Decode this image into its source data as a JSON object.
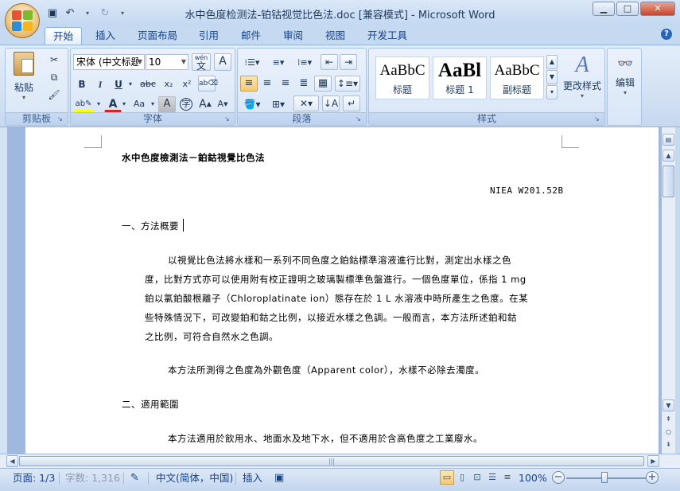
{
  "window": {
    "title": "水中色度检测法-铂钴视觉比色法.doc [兼容模式] - Microsoft Word",
    "controls": {
      "minimize": "▁",
      "maximize": "□",
      "close": "✕"
    }
  },
  "quick_access": {
    "save_icon": "save-icon",
    "undo_icon": "undo-icon",
    "redo_icon": "redo-icon"
  },
  "ribbon": {
    "tabs": [
      "开始",
      "插入",
      "页面布局",
      "引用",
      "邮件",
      "审阅",
      "视图",
      "开发工具"
    ],
    "active_tab": "开始",
    "clipboard": {
      "label": "剪贴板",
      "paste": "粘贴"
    },
    "font": {
      "label": "字体",
      "font_name": "宋体 (中文标题",
      "font_size": "10",
      "wen_label": "wén",
      "wen_char": "文",
      "a_box": "A",
      "bold": "B",
      "italic": "I",
      "underline": "U",
      "strike": "abc",
      "subscript": "x₂",
      "superscript": "x²",
      "aa": "Aa",
      "enclose": "字",
      "grow": "A",
      "shrink": "A"
    },
    "paragraph": {
      "label": "段落"
    },
    "styles": {
      "label": "样式",
      "items": [
        {
          "sample": "AaBbC",
          "name": "标题"
        },
        {
          "sample": "AaBl",
          "name": "标题 1"
        },
        {
          "sample": "AaBbC",
          "name": "副标题"
        }
      ],
      "change_styles": "更改样式"
    },
    "editing": {
      "label": "编辑"
    }
  },
  "document": {
    "title": "水中色度檢測法－鉑鈷視覺比色法",
    "code": "NIEA W201.52B",
    "section1": "一、方法概要",
    "para1": [
      "以視覺比色法將水樣和一系列不同色度之鉑鈷標準溶液進行比對，測定出水樣之色",
      "度，比對方式亦可以使用附有校正證明之玻璃製標準色盤進行。一個色度單位，係指 1  mg",
      "鉑以氯鉑酸根離子（Chloroplatinate ion）態存在於 1 L 水溶液中時所產生之色度。在某",
      "些特殊情況下，可改變鉑和鈷之比例，以接近水樣之色調。一般而言，本方法所述鉑和鈷",
      "之比例，可符合自然水之色調。"
    ],
    "para2": "本方法所測得之色度為外觀色度（Apparent  color），水樣不必除去濁度。",
    "section2": "二、適用範圍",
    "para3": "本方法適用於飲用水、地面水及地下水，但不適用於含高色度之工業廢水。"
  },
  "statusbar": {
    "page": "页面: 1/3",
    "words": "字数: 1,316",
    "language": "中文(简体，中国)",
    "mode": "插入",
    "zoom": "100%",
    "zoom_level_percent": 100
  }
}
